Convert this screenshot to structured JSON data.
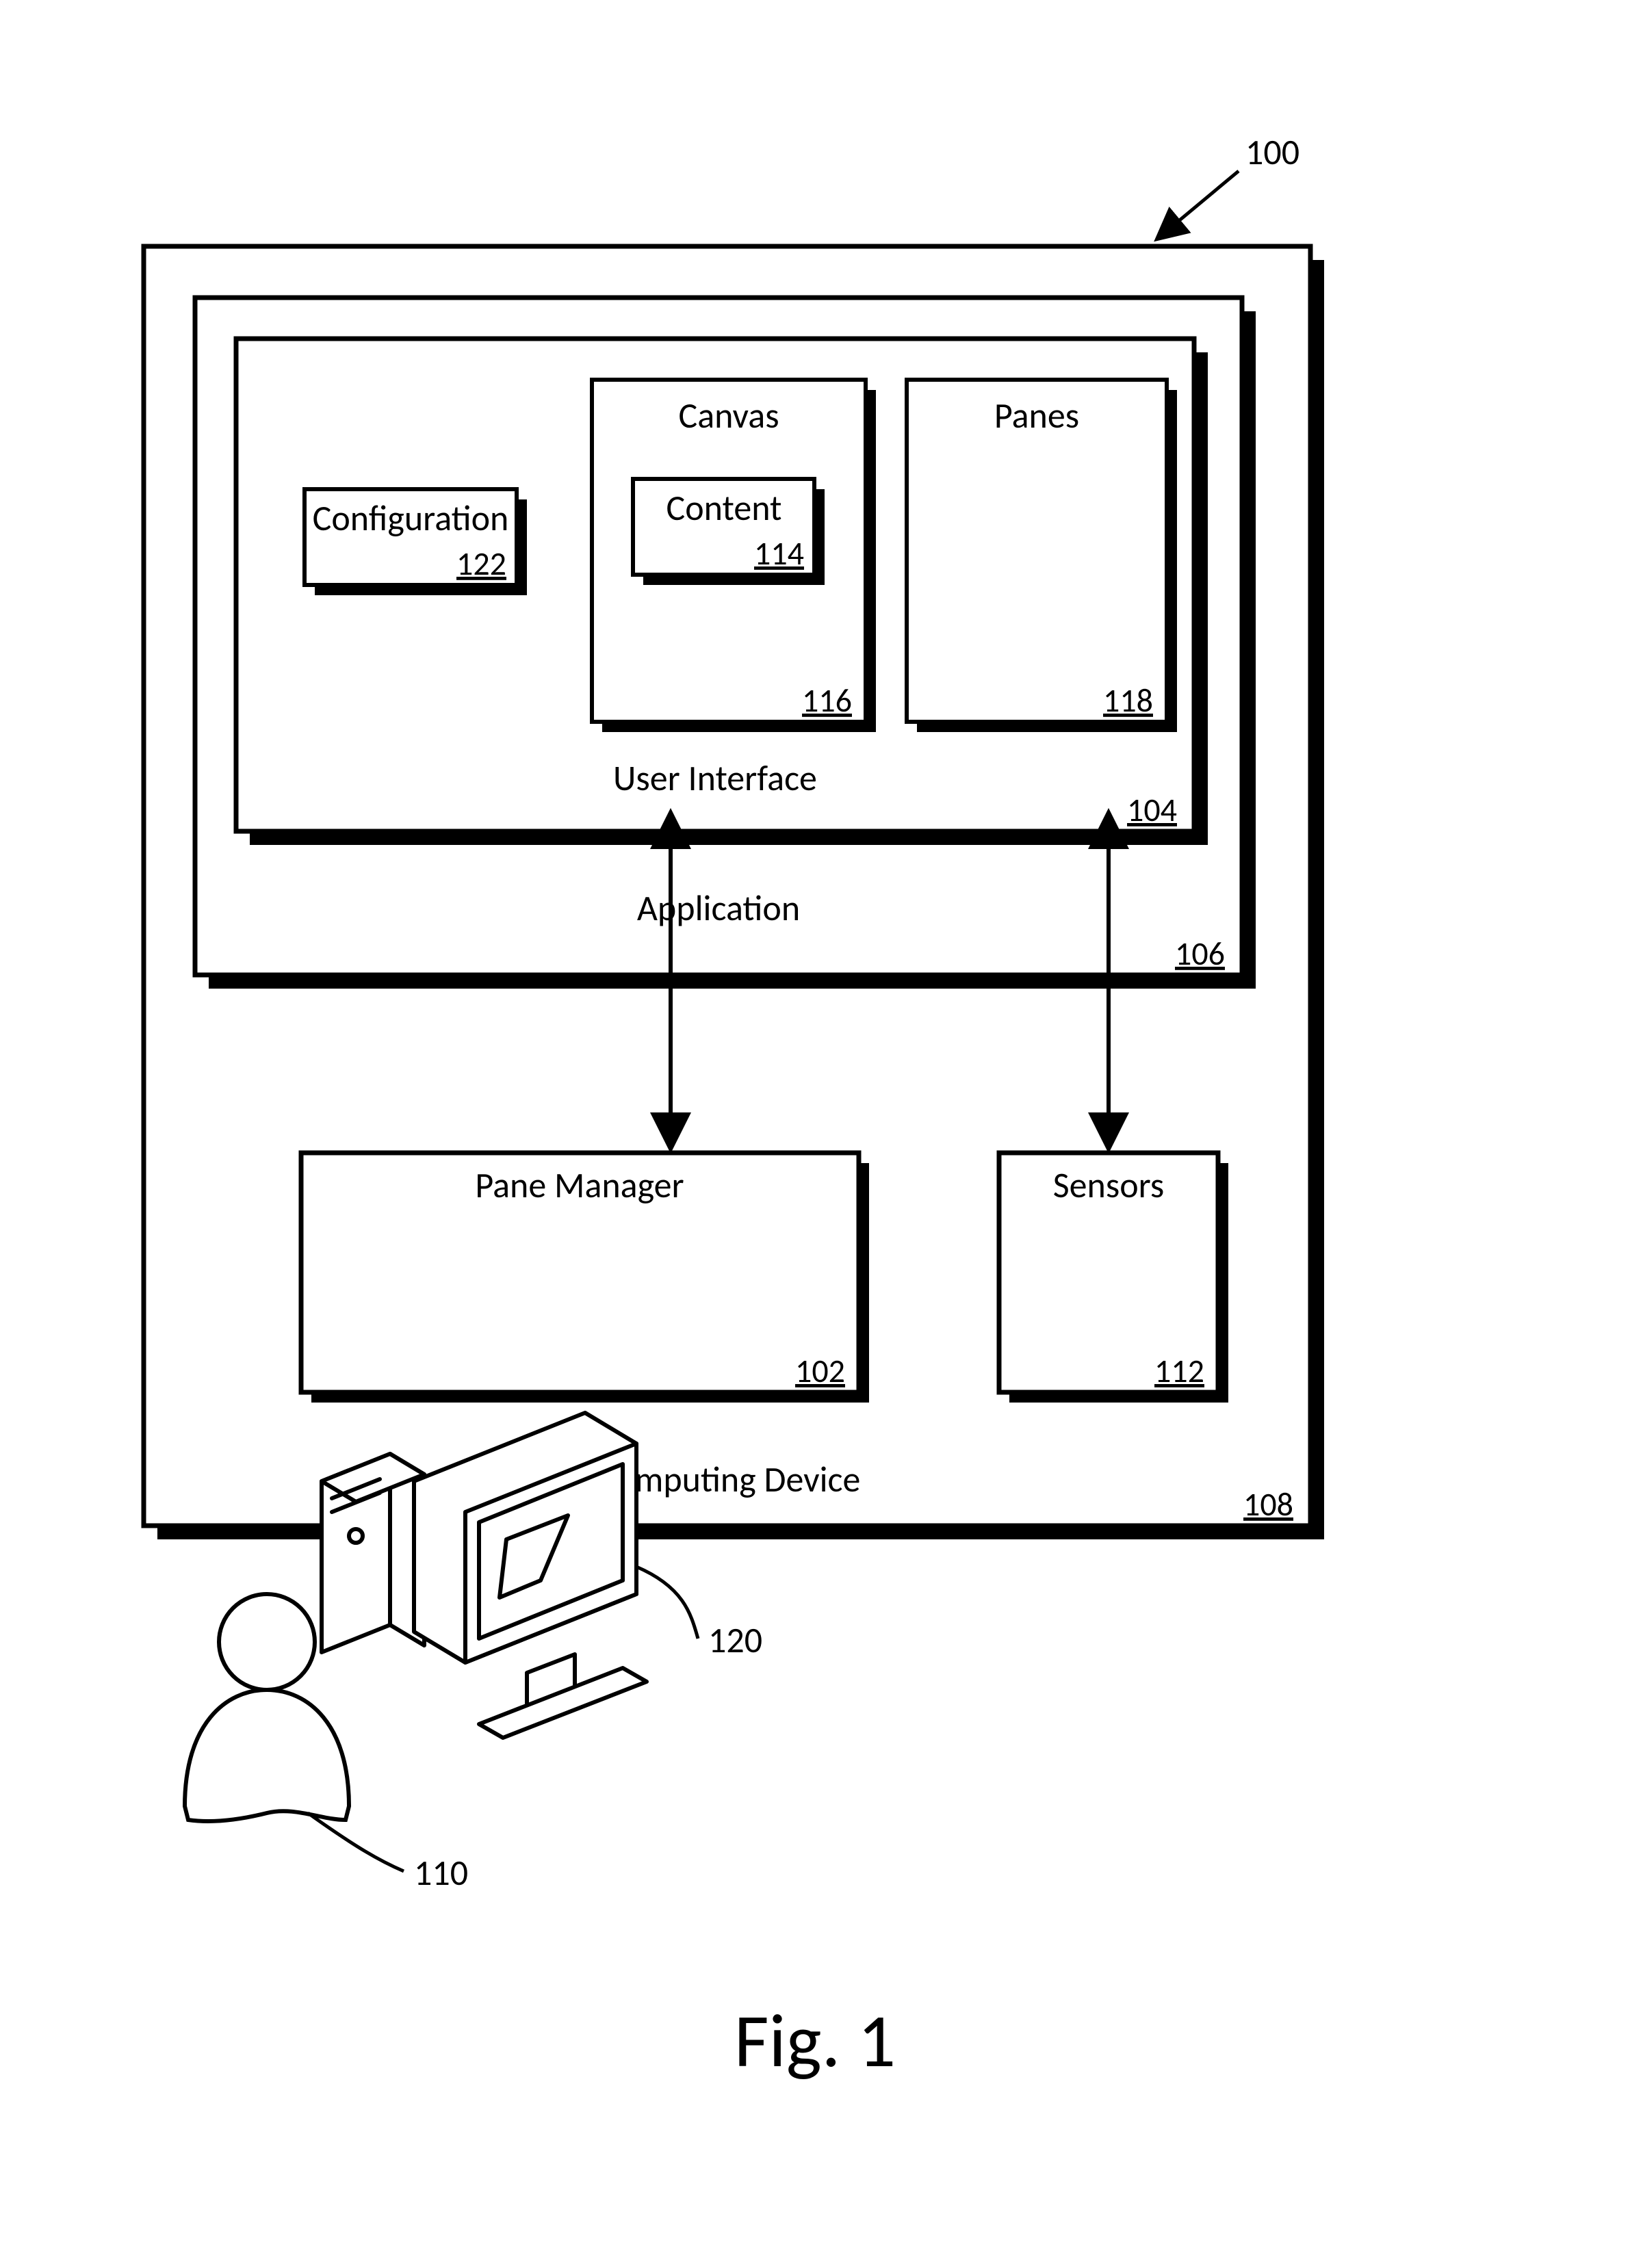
{
  "figure": {
    "caption": "Fig. 1",
    "overall_ref": "100",
    "computing_device": {
      "label": "Computing Device",
      "ref": "108"
    },
    "application": {
      "label": "Application",
      "ref": "106"
    },
    "user_interface": {
      "label": "User Interface",
      "ref": "104"
    },
    "configuration": {
      "label": "Configuration",
      "ref": "122"
    },
    "canvas": {
      "label": "Canvas",
      "ref": "116"
    },
    "content": {
      "label": "Content",
      "ref": "114"
    },
    "panes": {
      "label": "Panes",
      "ref": "118"
    },
    "pane_manager": {
      "label": "Pane Manager",
      "ref": "102"
    },
    "sensors": {
      "label": "Sensors",
      "ref": "112"
    },
    "user_ref": "110",
    "computer_ref": "120"
  }
}
